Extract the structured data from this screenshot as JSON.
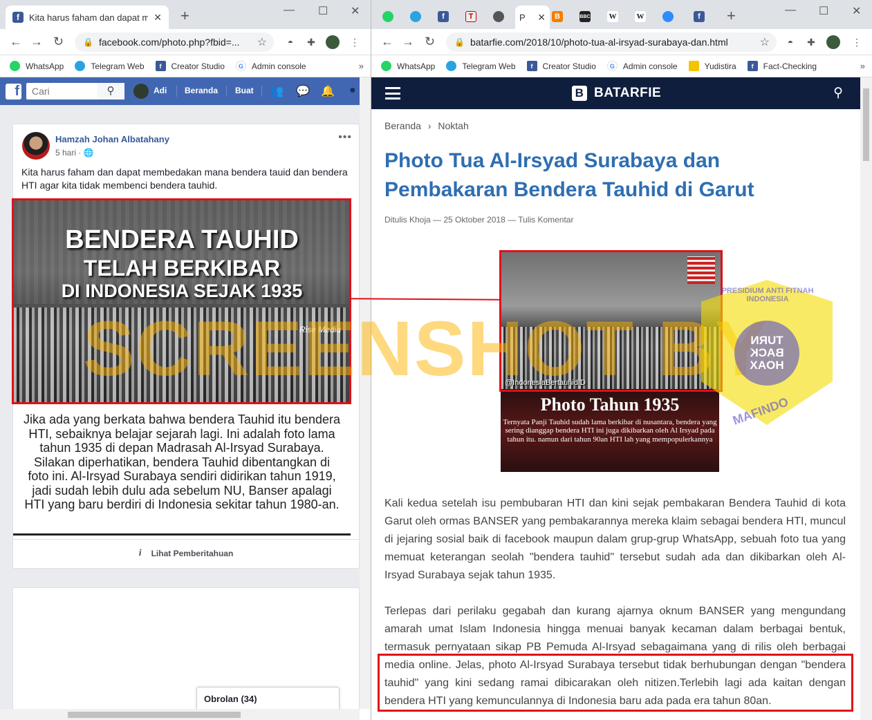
{
  "left_window": {
    "tab_title": "Kita harus faham dan dapat mem",
    "address": "facebook.com/photo.php?fbid=...",
    "bookmarks": [
      {
        "label": "WhatsApp",
        "color": "#25d366"
      },
      {
        "label": "Telegram Web",
        "color": "#2aa3e0"
      },
      {
        "label": "Creator Studio",
        "color": "#3b5998"
      },
      {
        "label": "Admin console",
        "color": "#4285f4"
      }
    ]
  },
  "facebook": {
    "logo": "f",
    "search_placeholder": "Cari",
    "user_name": "Adi",
    "nav_home": "Beranda",
    "nav_create": "Buat",
    "post": {
      "author": "Hamzah Johan Albatahany",
      "time": "5 hari · ",
      "text": "Kita harus faham dan dapat membedakan mana bendera tauid dan bendera HTI agar kita tidak membenci bendera tauhid.",
      "image_line1": "BENDERA TAUHID",
      "image_line2": "TELAH BERKIBAR",
      "image_line3": "DI INDONESIA SEJAK 1935",
      "image_brand": "Rise Media",
      "image_caption": "Jika ada yang berkata bahwa bendera Tauhid itu bendera HTI, sebaiknya belajar sejarah lagi. Ini adalah foto lama tahun 1935 di depan Madrasah Al-Irsyad Surabaya. Silakan diperhatikan, bendera Tauhid dibentangkan di foto ini. Al-Irsyad Surabaya sendiri didirikan tahun 1919, jadi sudah lebih dulu ada sebelum NU, Banser apalagi HTI yang baru berdiri di Indonesia sekitar tahun 1980-an.",
      "notice_link": "Lihat Pemberitahuan"
    },
    "chat_label": "Obrolan (34)"
  },
  "right_window": {
    "address": "batarfie.com/2018/10/photo-tua-al-irsyad-surabaya-dan.html",
    "active_tab_label": "P",
    "bookmarks": [
      {
        "label": "WhatsApp",
        "color": "#25d366"
      },
      {
        "label": "Telegram Web",
        "color": "#2aa3e0"
      },
      {
        "label": "Creator Studio",
        "color": "#3b5998"
      },
      {
        "label": "Admin console",
        "color": "#4285f4"
      },
      {
        "label": "Yudistira",
        "color": "#f5c400"
      },
      {
        "label": "Fact-Checking",
        "color": "#3b5998"
      }
    ]
  },
  "batarfie": {
    "site_name": "BATARFIE",
    "breadcrumb_home": "Beranda",
    "breadcrumb_sep": "›",
    "breadcrumb_section": "Noktah",
    "title": "Photo Tua Al-Irsyad Surabaya dan Pembakaran Bendera Tauhid di Garut",
    "byline": "Ditulis Khoja  —  25 Oktober 2018  —  Tulis Komentar",
    "photo_tag": "@IndonesiaBertauhidID",
    "caption_title": "Photo Tahun 1935",
    "caption_body": "Ternyata Panji Tauhid sudah lama berkibar di nusantara, bendera yang sering dianggap bendera HTI ini juga dikibarkan oleh Al Irsyad pada tahun itu. namun dari tahun 90an HTI lah yang mempopulerkannya",
    "paragraph1": "Kali kedua setelah isu pembubaran HTI dan kini sejak pembakaran Bendera Tauhid di kota Garut oleh ormas BANSER yang pembakarannya mereka klaim sebagai bendera HTI, muncul di jejaring sosial baik di facebook maupun dalam grup-grup WhatsApp, sebuah foto tua yang memuat keterangan seolah \"bendera tauhid\" tersebut sudah ada dan dikibarkan oleh Al-Irsyad Surabaya sejak tahun 1935.",
    "paragraph2": "Terlepas dari perilaku gegabah dan kurang ajarnya oknum BANSER yang mengundang amarah umat Islam Indonesia hingga menuai banyak kecaman dalam berbagai bentuk, termasuk pernyataan sikap PB Pemuda Al-Irsyad sebagaimana yang di rilis oleh berbagai media online. Jelas, photo Al-Irsyad Surabaya tersebut tidak berhubungan dengan \"bendera tauhid\" yang kini sedang ramai dibicarakan oleh nitizen.Terlebih lagi ada kaitan dengan bendera HTI yang kemunculannya di Indonesia baru ada pada era tahun 80an."
  },
  "overlays": {
    "watermark": "SCREENSHOT BY",
    "mafindo_ring": "PRESIDIUM ANTI FITNAH INDONESIA",
    "mafindo_center": "TURN BACK HOAX",
    "mafindo_name": "MAFINDO",
    "highlight_color": "#e0101a"
  }
}
